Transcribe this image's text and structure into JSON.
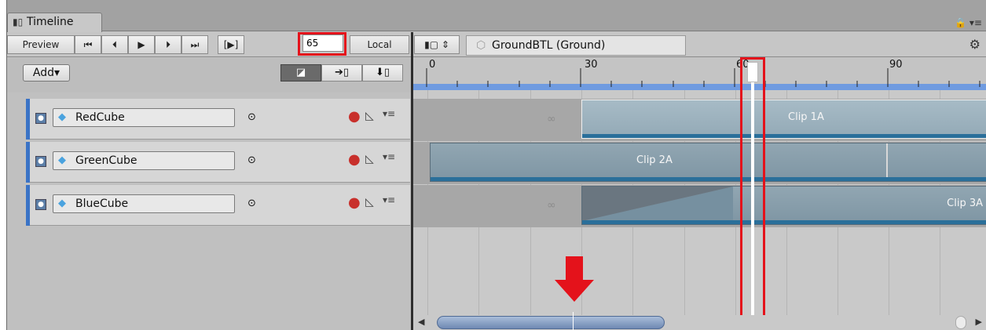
{
  "window": {
    "tab_title": "Timeline",
    "tab_icon": "timeline-icon"
  },
  "toolbar": {
    "preview_label": "Preview",
    "frame_value": "65",
    "local_label": "Local"
  },
  "header": {
    "asset_label": "GroundBTL (Ground)"
  },
  "left": {
    "add_label": "Add▾"
  },
  "ruler": {
    "ticks": [
      "0",
      "30",
      "60",
      "90"
    ]
  },
  "tracks": [
    {
      "name": "RedCube"
    },
    {
      "name": "GreenCube"
    },
    {
      "name": "BlueCube"
    }
  ],
  "clips": [
    {
      "label": "Clip 1A"
    },
    {
      "label": "Clip 2A"
    },
    {
      "label": "Clip 3A"
    }
  ],
  "colors": {
    "highlight": "#e4121b",
    "track_stripe": "#3a73c6",
    "clip_bar": "#2a6f9a",
    "ruler_blue": "#6f9be0"
  },
  "icons": {
    "infinity": "∞"
  }
}
